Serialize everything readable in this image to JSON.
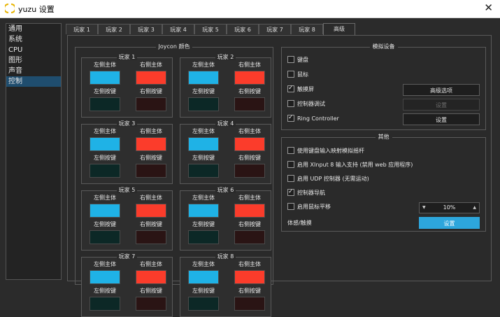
{
  "window": {
    "title": "yuzu 设置",
    "close": "✕"
  },
  "sidebar": {
    "items": [
      "通用",
      "系统",
      "CPU",
      "图形",
      "声音",
      "控制"
    ],
    "selected_index": 5
  },
  "tabs": [
    "玩家 1",
    "玩家 2",
    "玩家 3",
    "玩家 4",
    "玩家 5",
    "玩家 6",
    "玩家 7",
    "玩家 8",
    "高级"
  ],
  "active_tab_index": 8,
  "joycon": {
    "title": "Joycon 颜色",
    "left_body": "左侧主体",
    "right_body": "右侧主体",
    "left_buttons": "左侧按键",
    "right_buttons": "右侧按键",
    "players": [
      "玩家 1",
      "玩家 2",
      "玩家 3",
      "玩家 4",
      "玩家 5",
      "玩家 6",
      "玩家 7",
      "玩家 8"
    ]
  },
  "emulated": {
    "title": "模拟设备",
    "items": [
      {
        "label": "键盘",
        "checked": false
      },
      {
        "label": "鼠标",
        "checked": false
      },
      {
        "label": "触摸屏",
        "checked": true,
        "button": "高级选项",
        "button_enabled": true
      },
      {
        "label": "控制器调试",
        "checked": false,
        "button": "设置",
        "button_enabled": false
      },
      {
        "label": "Ring Controller",
        "checked": true,
        "button": "设置",
        "button_enabled": true
      }
    ]
  },
  "other": {
    "title": "其他",
    "items": [
      {
        "label": "使用键盘输入映射模拟摇杆",
        "checked": false
      },
      {
        "label": "启用 XInput 8 输入支持 (禁用 web 应用程序)",
        "checked": false
      },
      {
        "label": "启用 UDP 控制器 (无需运动)",
        "checked": false
      },
      {
        "label": "控制器导航",
        "checked": true
      },
      {
        "label": "启用鼠标平移",
        "checked": false
      }
    ],
    "mouse_sensitivity": "10%",
    "touch_label": "体感/触摸",
    "touch_button": "设置"
  },
  "colors": {
    "left_body": "#1fb2e6",
    "right_body": "#fb3c2b",
    "left_buttons": "#0c2826",
    "right_buttons": "#2a1414",
    "accent": "#2da6dc",
    "selected_sidebar": "#1f4d6e"
  }
}
